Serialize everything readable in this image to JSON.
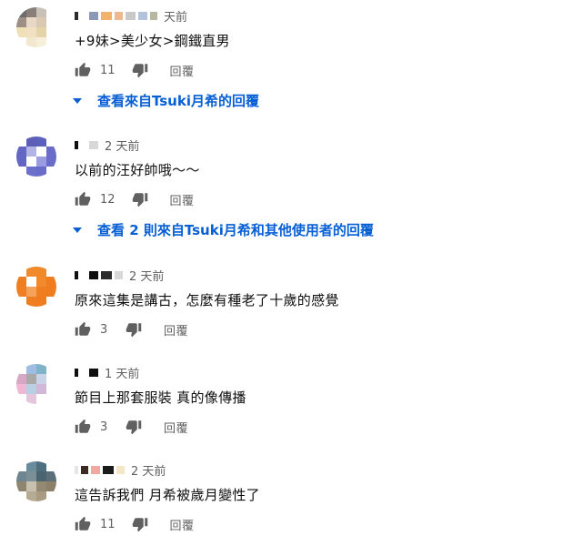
{
  "labels": {
    "reply": "回覆"
  },
  "comments": [
    {
      "time": "天前",
      "text": "+9妹>美少女>鋼鐵直男",
      "likes": "11",
      "view_replies": "查看來自Tsuki月希的回覆",
      "avatar_colors": [
        "#6b6b6b",
        "#8a7f78",
        "#c9c0b8",
        "#ffffff",
        "#9d8f85",
        "#e8d8c6",
        "#d9c9b3",
        "#ffffff",
        "#efe0b7",
        "#f1e1c2",
        "#e5d3a9",
        "#ffffff",
        "#ffffff",
        "#f2e7cf",
        "#f7efd9",
        "#ffffff"
      ],
      "name_colors": [
        "#2b2b2b",
        "#ffffff",
        "#8d97b6",
        "#f2b26b",
        "#efb88f",
        "#c9c9c9",
        "#b3c2dd",
        "#b6b8a0"
      ]
    },
    {
      "time": "2 天前",
      "text": "以前的汪好帥哦～～",
      "likes": "12",
      "view_replies": "查看 2 則來自Tsuki月希和其他使用者的回覆",
      "avatar_colors": [
        "#ffffff",
        "#5d5fb6",
        "#5b61bd",
        "#ffffff",
        "#6366c2",
        "#b3b4e6",
        "#ffffff",
        "#6a6dc8",
        "#6366c2",
        "#ffffff",
        "#9a9be0",
        "#6a6dc8",
        "#ffffff",
        "#6d70cb",
        "#6a6dc8",
        "#ffffff"
      ],
      "name_colors": [
        "#0f0f0f",
        "#ffffff",
        "#d8d8d8"
      ]
    },
    {
      "time": "2 天前",
      "text": "原來這集是講古，怎麼有種老了十歲的感覺",
      "likes": "3",
      "view_replies": "",
      "avatar_colors": [
        "#ffffff",
        "#f08a2c",
        "#f0892a",
        "#ffffff",
        "#ef7e20",
        "#ffffff",
        "#f28a2b",
        "#ef7c1e",
        "#ef7f22",
        "#f6a25a",
        "#ef7e20",
        "#ef7c1e",
        "#ffffff",
        "#ef7e20",
        "#ef7c1e",
        "#ffffff"
      ],
      "name_colors": [
        "#0f0f0f",
        "#ffffff",
        "#0f0f0f",
        "#2b2b2b",
        "#d8d8d8"
      ]
    },
    {
      "time": "1 天前",
      "text": "節目上那套服裝 真的像傳播",
      "likes": "3",
      "view_replies": "",
      "avatar_colors": [
        "#ffffff",
        "#9fbde0",
        "#7fb3c8",
        "#ffffff",
        "#d6a8c6",
        "#a9a9a9",
        "#c9d3e8",
        "#ffffff",
        "#f0b7d5",
        "#b9d0e3",
        "#d2b8d8",
        "#ffffff",
        "#ffffff",
        "#e6c6da",
        "#ffffff",
        "#ffffff"
      ],
      "name_colors": [
        "#0f0f0f",
        "#ffffff",
        "#0f0f0f"
      ]
    },
    {
      "time": "2 天前",
      "text": "這告訴我們 月希被歲月變性了",
      "likes": "11",
      "view_replies": "",
      "avatar_colors": [
        "#ffffff",
        "#6a8c9b",
        "#4e6f7e",
        "#ffffff",
        "#6f8590",
        "#7b8f96",
        "#4b6470",
        "#5b6f78",
        "#8f8670",
        "#c8c0ae",
        "#948a73",
        "#8d8068",
        "#ffffff",
        "#b6ab94",
        "#a89b82",
        "#ffffff"
      ],
      "name_colors": [
        "#e6e6e6",
        "#3b2a22",
        "#f2a7a0",
        "#1a1a1a",
        "#f5e6c8"
      ]
    }
  ]
}
